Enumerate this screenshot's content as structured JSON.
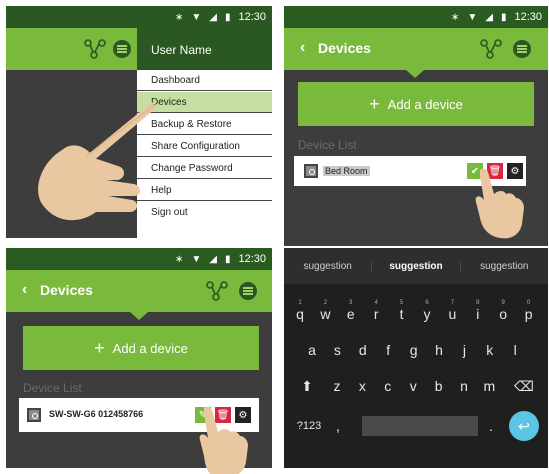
{
  "status": {
    "time": "12:30",
    "bt": "∗",
    "wifi": "▼",
    "signal": "◢",
    "battery": "▮"
  },
  "panel1": {
    "drawer": {
      "user_name": "User Name",
      "items": [
        {
          "label": "Dashboard",
          "active": false
        },
        {
          "label": "Devices",
          "active": true
        },
        {
          "label": "Backup & Restore",
          "active": false
        },
        {
          "label": "Share Configuration",
          "active": false
        },
        {
          "label": "Change Password",
          "active": false
        },
        {
          "label": "Help",
          "active": false
        },
        {
          "label": "Sign out",
          "active": false
        }
      ]
    }
  },
  "panel2": {
    "title": "Devices",
    "add_label": "Add a device",
    "list_label": "Device List",
    "device_name": "Bed Room"
  },
  "panel3": {
    "title": "Devices",
    "add_label": "Add a device",
    "list_label": "Device List",
    "device_name": "SW-SW-G6 012458766"
  },
  "panel4": {
    "suggestions": [
      "suggestion",
      "suggestion",
      "suggestion"
    ],
    "row1": [
      {
        "k": "q",
        "n": "1"
      },
      {
        "k": "w",
        "n": "2"
      },
      {
        "k": "e",
        "n": "3"
      },
      {
        "k": "r",
        "n": "4"
      },
      {
        "k": "t",
        "n": "5"
      },
      {
        "k": "y",
        "n": "6"
      },
      {
        "k": "u",
        "n": "7"
      },
      {
        "k": "i",
        "n": "8"
      },
      {
        "k": "o",
        "n": "9"
      },
      {
        "k": "p",
        "n": "0"
      }
    ],
    "row2": [
      "a",
      "s",
      "d",
      "f",
      "g",
      "h",
      "j",
      "k",
      "l"
    ],
    "row3": [
      "z",
      "x",
      "c",
      "v",
      "b",
      "n",
      "m"
    ],
    "shift_glyph": "⬆",
    "backspace_glyph": "⌫",
    "symbols_label": "?123",
    "comma": ",",
    "period": ".",
    "enter_glyph": "↩"
  }
}
